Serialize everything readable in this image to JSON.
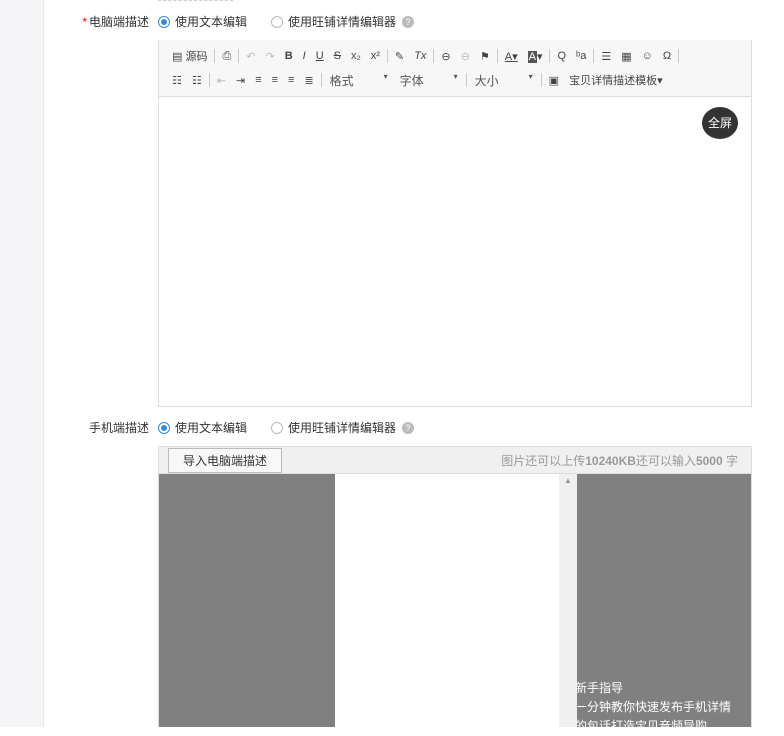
{
  "pc_desc": {
    "required_mark": "*",
    "label": "电脑端描述",
    "options": [
      {
        "label": "使用文本编辑",
        "selected": true
      },
      {
        "label": "使用旺铺详情编辑器",
        "selected": false
      }
    ],
    "help": "?"
  },
  "toolbar": {
    "source": "源码",
    "format": "格式",
    "font": "字体",
    "size": "大小",
    "template": "宝贝详情描述模板",
    "fullscreen": "全屏",
    "glyphs": {
      "bold": "B",
      "italic": "I",
      "underline": "U",
      "strike": "S",
      "sub": "x₂",
      "sup": "x²",
      "clear": "Tx",
      "fontcolor": "A",
      "bgcolor": "A",
      "find": "Q",
      "omega": "Ω",
      "emoji": "☺"
    }
  },
  "mobile_desc": {
    "label": "手机端描述",
    "options": [
      {
        "label": "使用文本编辑",
        "selected": true
      },
      {
        "label": "使用旺铺详情编辑器",
        "selected": false
      }
    ],
    "help": "?",
    "import_button": "导入电脑端描述",
    "info_prefix": "图片还可以上传",
    "info_kb": "10240KB",
    "info_mid": "还可以输入",
    "info_chars": "5000",
    "info_suffix": " 字",
    "guide_title": "新手指导",
    "guide_line1": "一分钟教你快速发布手机详情",
    "guide_line2": "的包话打造宝贝音频导购"
  }
}
